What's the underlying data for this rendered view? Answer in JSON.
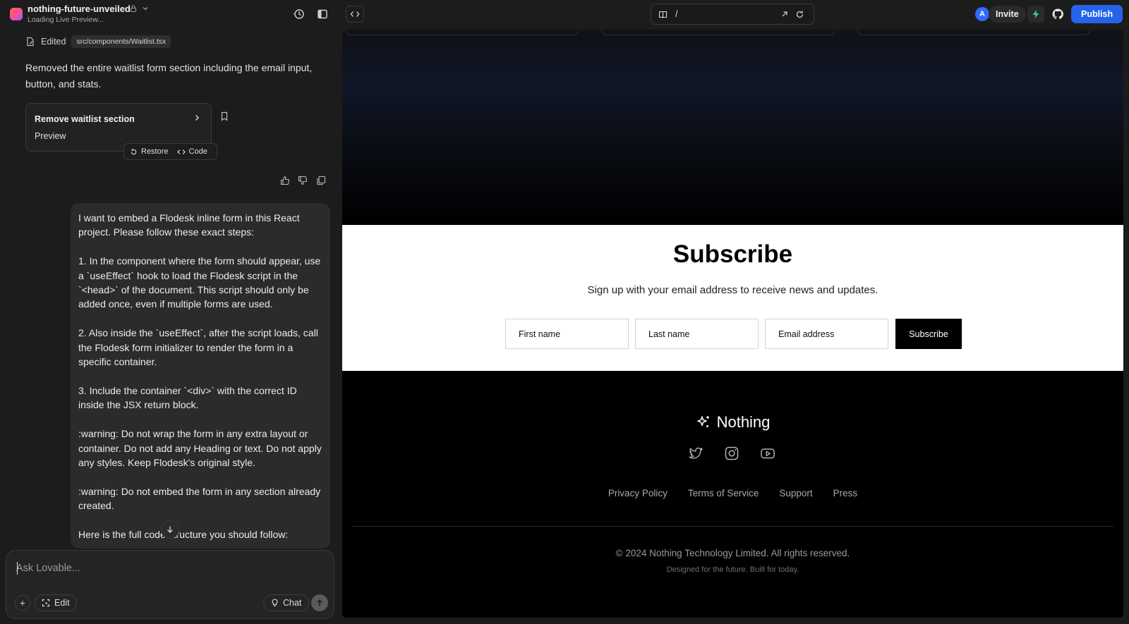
{
  "project": {
    "name": "nothing-future-unveiled",
    "status": "Loading Live Preview..."
  },
  "chat": {
    "edited_label": "Edited",
    "edited_file": "src/components/Waitlist.tsx",
    "summary": "Removed the entire waitlist form section including the email input, button, and stats.",
    "version_card": {
      "title": "Remove waitlist section",
      "subtitle": "Preview",
      "restore_label": "Restore",
      "code_label": "Code"
    },
    "user_message": "I want to embed a Flodesk inline form in this React project. Please follow these exact steps:\n\n1. In the component where the form should appear, use a `useEffect` hook to load the Flodesk script in the `<head>` of the document. This script should only be added once, even if multiple forms are used.\n\n2. Also inside the `useEffect`, after the script loads, call the Flodesk form initializer to render the form in a specific container.\n\n3. Include the container `<div>` with the correct ID inside the JSX return block.\n\n:warning: Do not wrap the form in any extra layout or container. Do not add any Heading or text. Do not apply any styles. Keep Flodesk's original style.\n\n:warning: Do not embed the form in any section already created.\n\nHere is the full code structure you should follow:"
  },
  "composer": {
    "placeholder": "Ask Lovable...",
    "value": "",
    "plus_label": "+",
    "edit_label": "Edit",
    "chat_label": "Chat"
  },
  "topbar": {
    "url_path": "/",
    "avatar_initial": "A",
    "invite_label": "Invite",
    "publish_label": "Publish",
    "accent_color": "#2563eb"
  },
  "preview": {
    "subscribe": {
      "title": "Subscribe",
      "description": "Sign up with your email address to receive news and updates.",
      "first_name_placeholder": "First name",
      "last_name_placeholder": "Last name",
      "email_placeholder": "Email address",
      "button_label": "Subscribe"
    },
    "footer": {
      "brand": "Nothing",
      "links": [
        "Privacy Policy",
        "Terms of Service",
        "Support",
        "Press"
      ],
      "copyright": "© 2024 Nothing Technology Limited. All rights reserved.",
      "tagline": "Designed for the future. Built for today."
    }
  },
  "icons": [
    "lock-icon",
    "chevron-down-icon",
    "history-icon",
    "sidebar-toggle-icon",
    "file-edit-icon",
    "chevron-right-icon",
    "bookmark-icon",
    "restore-icon",
    "code-icon",
    "thumbs-up-icon",
    "thumbs-down-icon",
    "copy-icon",
    "arrow-down-icon",
    "lightbulb-icon",
    "arrow-up-icon",
    "book-icon",
    "external-link-icon",
    "refresh-icon",
    "bolt-icon",
    "github-icon",
    "sparkle-icon",
    "twitter-icon",
    "instagram-icon",
    "youtube-icon"
  ]
}
